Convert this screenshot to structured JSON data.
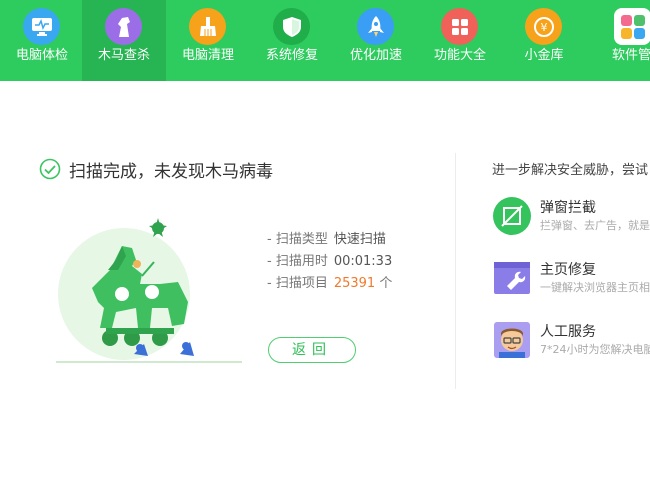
{
  "nav": {
    "items": [
      {
        "label": "电脑体检",
        "icon": "monitor-icon"
      },
      {
        "label": "木马查杀",
        "icon": "horse-icon",
        "active": true
      },
      {
        "label": "电脑清理",
        "icon": "broom-icon"
      },
      {
        "label": "系统修复",
        "icon": "shield-icon"
      },
      {
        "label": "优化加速",
        "icon": "rocket-icon"
      },
      {
        "label": "功能大全",
        "icon": "grid-icon"
      },
      {
        "label": "小金库",
        "icon": "coin-icon"
      },
      {
        "label": "软件管家",
        "icon": "software-icon"
      }
    ]
  },
  "result": {
    "title": "扫描完成，未发现木马病毒",
    "stats": [
      {
        "label": "- 扫描类型",
        "value": "快速扫描"
      },
      {
        "label": "- 扫描用时",
        "value": "00:01:33"
      },
      {
        "label": "- 扫描项目",
        "value": "25391",
        "unit": "个"
      }
    ],
    "back_label": "返回"
  },
  "side": {
    "title": "进一步解决安全威胁，尝试",
    "features": [
      {
        "title": "弹窗拦截",
        "desc": "拦弹窗、去广告，就是",
        "icon": "popup-block-icon"
      },
      {
        "title": "主页修复",
        "desc": "一键解决浏览器主页相",
        "icon": "wrench-icon"
      },
      {
        "title": "人工服务",
        "desc": "7*24小时为您解决电脑",
        "icon": "support-person-icon"
      }
    ]
  },
  "colors": {
    "nav_bg": "#2ecb5e",
    "nav_active_bg": "#26b552",
    "accent_green": "#2ebf55",
    "orange": "#f0792b"
  }
}
